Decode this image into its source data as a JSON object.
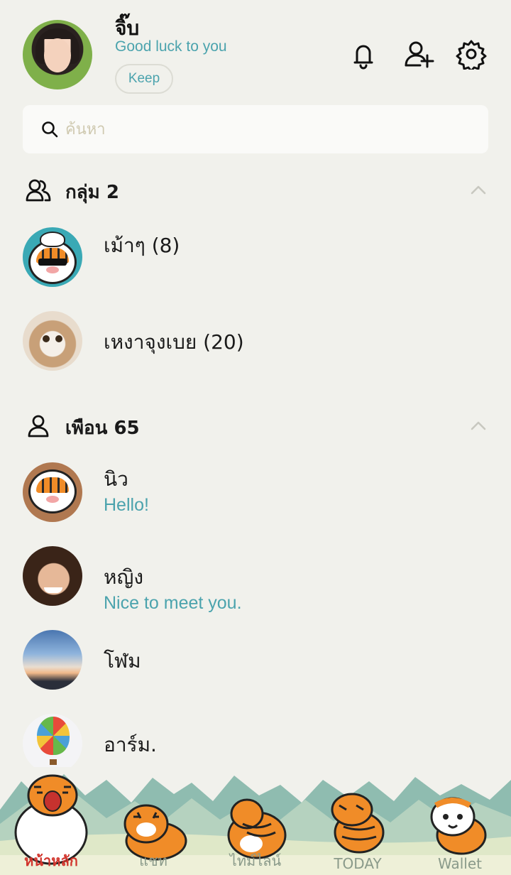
{
  "profile": {
    "name": "จิ๊บ",
    "status": "Good luck to you",
    "keep_label": "Keep"
  },
  "header_icons": [
    "bell-icon",
    "add-friend-icon",
    "settings-gear-icon"
  ],
  "search": {
    "placeholder": "ค้นหา"
  },
  "groups": {
    "title": "กลุ่ม 2",
    "items": [
      {
        "name": "เม้าๆ (8)"
      },
      {
        "name": "เหงาจุงเบย (20)"
      }
    ]
  },
  "friends": {
    "title": "เพือน 65",
    "items": [
      {
        "name": "นิว",
        "message": "Hello!"
      },
      {
        "name": "หญิง",
        "message": "Nice to meet you."
      },
      {
        "name": "โฬม",
        "message": ""
      },
      {
        "name": "อาร์ม.",
        "message": ""
      }
    ]
  },
  "tabs": [
    {
      "label": "หน้าหลัก",
      "active": true
    },
    {
      "label": "แชท",
      "active": false
    },
    {
      "label": "ไทม์ไลน์",
      "active": false
    },
    {
      "label": "TODAY",
      "active": false
    },
    {
      "label": "Wallet",
      "active": false
    }
  ],
  "colors": {
    "background": "#f1f1ec",
    "accent_teal": "#4ba3ad",
    "active_tab": "#d1342c",
    "tiger_orange": "#f08c28"
  }
}
